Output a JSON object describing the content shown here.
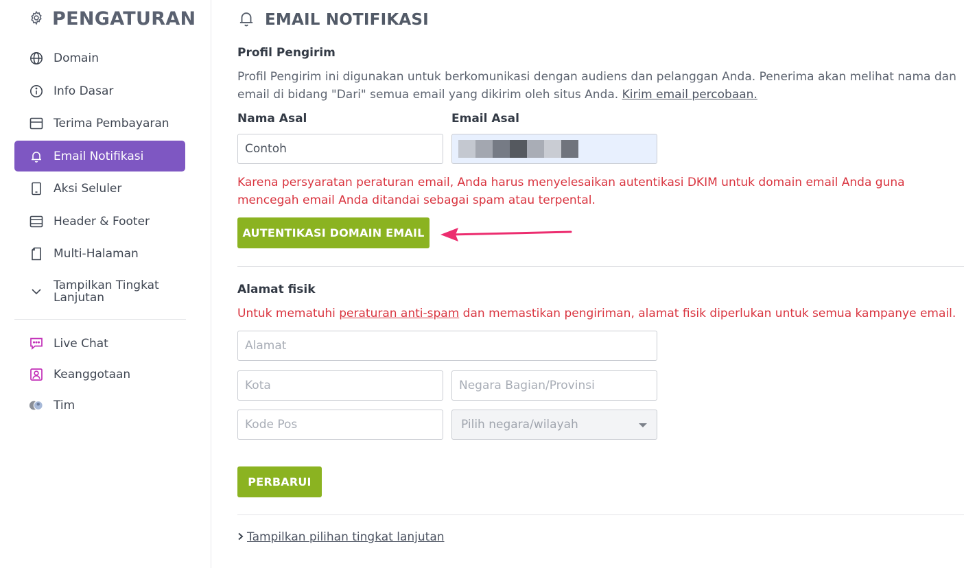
{
  "sidebar": {
    "title": "PENGATURAN",
    "items": [
      {
        "label": "Domain",
        "icon": "globe-icon"
      },
      {
        "label": "Info Dasar",
        "icon": "info-icon"
      },
      {
        "label": "Terima Pembayaran",
        "icon": "payment-icon"
      },
      {
        "label": "Email Notifikasi",
        "icon": "bell-icon",
        "active": true
      },
      {
        "label": "Aksi Seluler",
        "icon": "mobile-icon"
      },
      {
        "label": "Header & Footer",
        "icon": "layout-icon"
      },
      {
        "label": "Multi-Halaman",
        "icon": "page-icon"
      },
      {
        "label": "Tampilkan Tingkat Lanjutan",
        "icon": "chevron-down-icon"
      }
    ],
    "apps": [
      {
        "label": "Live Chat",
        "icon": "chat-icon",
        "color": "#c22fb8"
      },
      {
        "label": "Keanggotaan",
        "icon": "member-icon",
        "color": "#c22fb8"
      },
      {
        "label": "Tim",
        "icon": "team-avatars-icon"
      }
    ]
  },
  "main": {
    "title": "EMAIL NOTIFIKASI",
    "sender_profile": {
      "heading": "Profil Pengirim",
      "description": "Profil Pengirim ini digunakan untuk berkomunikasi dengan audiens dan pelanggan Anda. Penerima akan melihat nama dan email di bidang \"Dari\" semua email yang dikirim oleh situs Anda.",
      "test_link": "Kirim email percobaan.",
      "name_label": "Nama Asal",
      "name_value": "Contoh",
      "email_label": "Email Asal",
      "warning": "Karena persyaratan peraturan email, Anda harus menyelesaikan autentikasi DKIM untuk domain email Anda guna mencegah email Anda ditandai sebagai spam atau terpental.",
      "auth_button": "AUTENTIKASI DOMAIN EMAIL"
    },
    "address": {
      "heading": "Alamat fisik",
      "notice_before": "Untuk mematuhi ",
      "notice_link": "peraturan anti-spam",
      "notice_after": " dan memastikan pengiriman, alamat fisik diperlukan untuk semua kampanye email.",
      "street_placeholder": "Alamat",
      "city_placeholder": "Kota",
      "state_placeholder": "Negara Bagian/Provinsi",
      "zip_placeholder": "Kode Pos",
      "country_placeholder": "Pilih negara/wilayah"
    },
    "update_button": "PERBARUI",
    "advanced_link": "Tampilkan pilihan tingkat lanjutan"
  },
  "colors": {
    "accent_purple": "#7e57c2",
    "button_green": "#8bb321",
    "warning_red": "#d9343f",
    "arrow_pink": "#ec2d6f"
  }
}
